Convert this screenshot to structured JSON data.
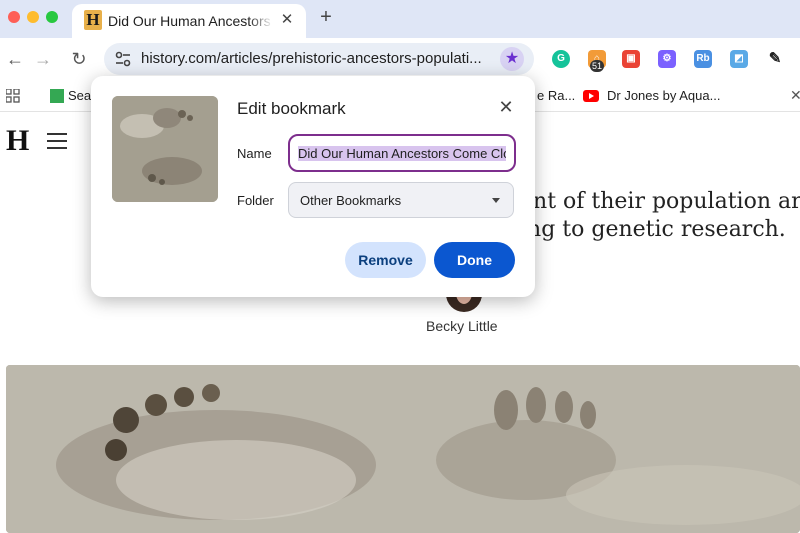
{
  "browser": {
    "tab": {
      "title": "Did Our Human Ancestors Co",
      "favicon_letter": "H"
    },
    "omnibox": {
      "url": "history.com/articles/prehistoric-ancestors-populati..."
    },
    "extension_badge": "51",
    "bookmarks": [
      {
        "label": "Sea"
      },
      {
        "label": "e Ra..."
      },
      {
        "label": "Dr Jones by Aqua..."
      }
    ]
  },
  "page": {
    "logo": "H",
    "headline_line1": "ent of their population aroun",
    "headline_line2": "ing to genetic research.",
    "author": "Becky Little"
  },
  "dialog": {
    "title": "Edit bookmark",
    "name_label": "Name",
    "name_value": "Did Our Human Ancestors Come Close",
    "folder_label": "Folder",
    "folder_value": "Other Bookmarks",
    "remove_label": "Remove",
    "done_label": "Done"
  }
}
